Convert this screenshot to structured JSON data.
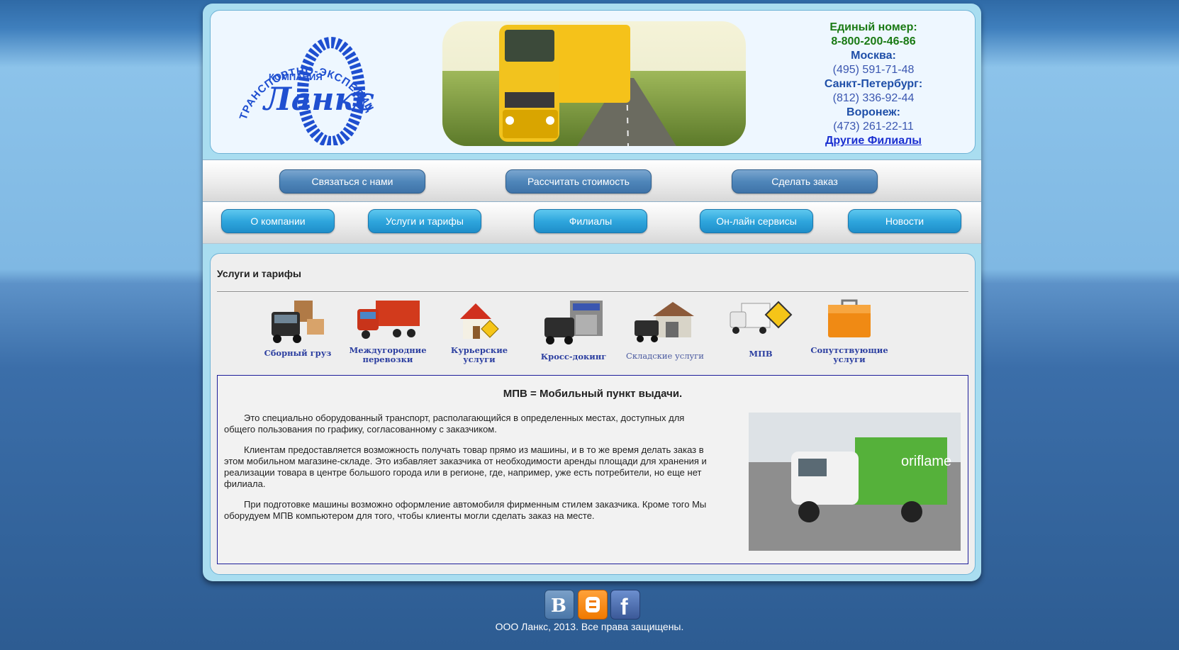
{
  "header": {
    "logo": {
      "arc_text": "ТРАНСПОРТНО-ЭКСПЕДИЦИОННАЯ",
      "small_text": "КОМПАНИЯ",
      "brand": "Ланкс"
    },
    "contacts": {
      "single_label": "Единый номер:",
      "single_phone": "8-800-200-46-86",
      "moscow_label": "Москва:",
      "moscow_phone": "(495) 591-71-48",
      "spb_label": "Санкт-Петербург:",
      "spb_phone": "(812) 336-92-44",
      "voronezh_label": "Воронеж:",
      "voronezh_phone": "(473) 261-22-11",
      "other_link": "Другие Филиалы"
    }
  },
  "nav_top": [
    "Связаться с нами",
    "Рассчитать стоимость",
    "Сделать заказ"
  ],
  "nav_main": [
    "О компании",
    "Услуги и тарифы",
    "Филиалы",
    "Он-лайн сервисы",
    "Новости"
  ],
  "content": {
    "section_title": "Услуги и тарифы",
    "services": [
      {
        "line1": "Сборный груз",
        "line2": "",
        "icon": "truck-with-boxes-icon"
      },
      {
        "line1": "Междугородние",
        "line2": "перевозки",
        "icon": "red-truck-icon"
      },
      {
        "line1": "Курьерские",
        "line2": "услуги",
        "icon": "house-delivery-icon"
      },
      {
        "line1": "Кросс-докинг",
        "line2": "",
        "icon": "truck-warehouse-icon"
      },
      {
        "line1": "Складские услуги",
        "line2": "",
        "icon": "warehouse-icon"
      },
      {
        "line1": "МПВ",
        "line2": "",
        "icon": "mobile-point-van-icon"
      },
      {
        "line1": "Сопутствующие",
        "line2": "услуги",
        "icon": "orange-box-icon"
      }
    ],
    "info": {
      "title": "МПВ = Мобильный пункт выдачи.",
      "paragraphs": [
        "Это специально оборудованный транспорт, располагающийся в определенных местах, доступных для общего пользования по графику, согласованному с заказчиком.",
        "Клиентам предоставляется возможность получать товар прямо из машины, и в то же время делать заказ в этом мобильном магазине-складе. Это избавляет заказчика от необходимости аренды площади для хранения и реализации товара в центре большого города или в регионе, где, например, уже есть потребители, но еще нет филиала.",
        "При подготовке машины возможно оформление автомобиля фирменным стилем заказчика. Кроме того Мы оборудуем МПВ компьютером для того, чтобы клиенты могли сделать заказ на месте."
      ],
      "photo_brand": "oriflame"
    }
  },
  "footer": {
    "social": [
      "vk-icon",
      "blogger-icon",
      "facebook-icon"
    ],
    "copyright": "ООО Ланкс, 2013. Все права защищены."
  },
  "colors": {
    "accent_blue": "#2fa6dd",
    "dark_button": "#4f86ba",
    "contact_green": "#1a7a14",
    "service_label": "#2c3fa0"
  }
}
